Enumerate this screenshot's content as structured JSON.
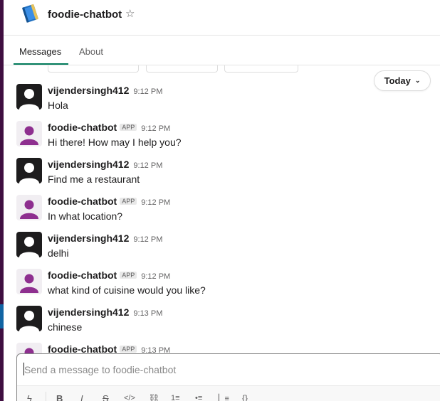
{
  "header": {
    "title": "foodie-chatbot",
    "logo_icon": "book-icon",
    "star_icon": "☆"
  },
  "tabs": [
    {
      "label": "Messages",
      "active": true
    },
    {
      "label": "About",
      "active": false
    }
  ],
  "day_divider": {
    "label": "Today",
    "chevron": "⌄"
  },
  "messages": [
    {
      "author": "vijendersingh412",
      "is_app": false,
      "time": "9:12 PM",
      "text": "Hola"
    },
    {
      "author": "foodie-chatbot",
      "is_app": true,
      "badge": "APP",
      "time": "9:12 PM",
      "text": "Hi there! How may I help you?"
    },
    {
      "author": "vijendersingh412",
      "is_app": false,
      "time": "9:12 PM",
      "text": "Find me a restaurant"
    },
    {
      "author": "foodie-chatbot",
      "is_app": true,
      "badge": "APP",
      "time": "9:12 PM",
      "text": "In what location?"
    },
    {
      "author": "vijendersingh412",
      "is_app": false,
      "time": "9:12 PM",
      "text": "delhi"
    },
    {
      "author": "foodie-chatbot",
      "is_app": true,
      "badge": "APP",
      "time": "9:12 PM",
      "text": "what kind of cuisine would you like?"
    },
    {
      "author": "vijendersingh412",
      "is_app": false,
      "time": "9:13 PM",
      "text": "chinese"
    },
    {
      "author": "foodie-chatbot",
      "is_app": true,
      "badge": "APP",
      "time": "9:13 PM",
      "text": ""
    }
  ],
  "composer": {
    "placeholder": "Send a message to foodie-chatbot",
    "value": "",
    "toolbar": {
      "shortcuts": "ϟ",
      "bold": "B",
      "italic": "I",
      "strike": "S",
      "code": "</>",
      "link": "⛓",
      "ordered_list": "1≡",
      "bulleted_list": "•≡",
      "quote": "▏≡",
      "code_block": "{}"
    }
  },
  "colors": {
    "sidebar": "#3f0e40",
    "active_tab": "#007a5a",
    "bot_avatar": "#8e2f8f",
    "user_avatar": "#1d1c1d"
  }
}
